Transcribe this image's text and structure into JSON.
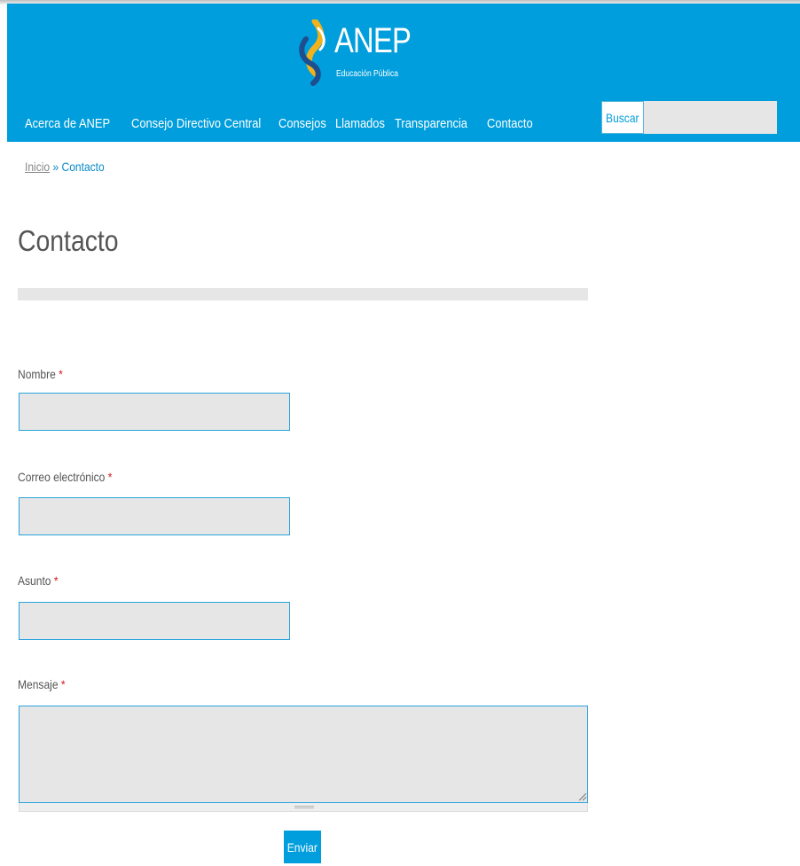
{
  "header": {
    "logo_text": "ANEP",
    "logo_subtitle": "Educación Pública",
    "brand_color": "#009edc"
  },
  "nav": {
    "items": [
      {
        "label": "Acerca de ANEP"
      },
      {
        "label": "Consejo Directivo Central"
      },
      {
        "label": "Consejos"
      },
      {
        "label": "Llamados"
      },
      {
        "label": "Transparencia"
      },
      {
        "label": "Contacto"
      }
    ]
  },
  "search": {
    "button_label": "Buscar",
    "value": ""
  },
  "breadcrumb": {
    "home": "Inicio",
    "separator": " » ",
    "current": "Contacto"
  },
  "page": {
    "title": "Contacto"
  },
  "form": {
    "required_mark": "*",
    "name_label": "Nombre",
    "name_value": "",
    "email_label": "Correo electrónico",
    "email_value": "",
    "subject_label": "Asunto",
    "subject_value": "",
    "message_label": "Mensaje",
    "message_value": "",
    "submit_label": "Enviar"
  }
}
